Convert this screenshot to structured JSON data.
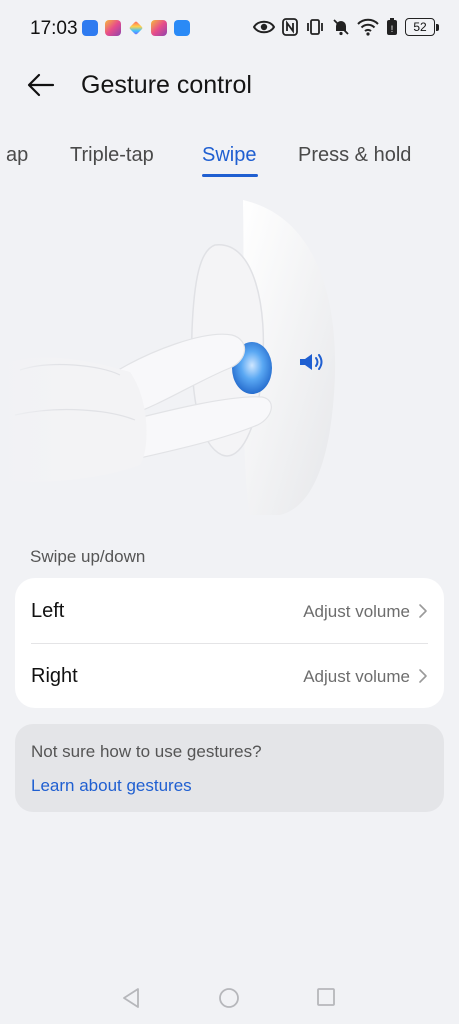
{
  "status_bar": {
    "time": "17:03",
    "battery": "52",
    "notification_icons": [
      "bluetooth-icon",
      "instagram-icon",
      "app-cube-icon",
      "instagram-icon",
      "cloud-icon"
    ],
    "system_icons": [
      "eye-icon",
      "nfc-icon",
      "vibrate-icon",
      "silent-bell-icon",
      "wifi-icon",
      "battery-saver-icon",
      "battery-icon"
    ]
  },
  "header": {
    "title": "Gesture control"
  },
  "tabs": {
    "items": [
      {
        "label": "ap"
      },
      {
        "label": "Triple-tap"
      },
      {
        "label": "Swipe"
      },
      {
        "label": "Press & hold"
      }
    ],
    "active": "Swipe"
  },
  "section": {
    "label": "Swipe up/down",
    "rows": [
      {
        "label": "Left",
        "value": "Adjust volume"
      },
      {
        "label": "Right",
        "value": "Adjust volume"
      }
    ]
  },
  "help": {
    "question": "Not sure how to use gestures?",
    "link": "Learn about gestures"
  },
  "colors": {
    "accent": "#1f5fd1",
    "background": "#f1f2f5",
    "card": "#ffffff"
  }
}
